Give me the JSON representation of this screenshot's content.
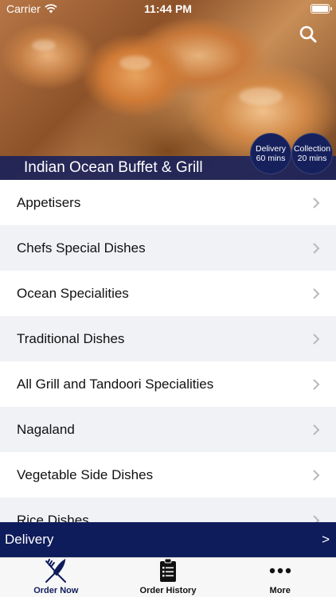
{
  "status_bar": {
    "carrier": "Carrier",
    "time": "11:44 PM"
  },
  "header": {
    "restaurant_name": "Indian Ocean Buffet & Grill",
    "delivery_badge": {
      "line1": "Delivery",
      "line2": "60 mins"
    },
    "collection_badge": {
      "line1": "Collection",
      "line2": "20 mins"
    },
    "search_icon": "search-icon"
  },
  "categories": [
    "Appetisers",
    "Chefs Special Dishes",
    "Ocean Specialities",
    "Traditional Dishes",
    "All Grill and Tandoori Specialities",
    "Nagaland",
    "Vegetable Side Dishes",
    "Rice Dishes"
  ],
  "order_mode_bar": {
    "label": "Delivery",
    "arrow": ">"
  },
  "tabs": [
    {
      "label": "Order Now",
      "icon": "fork-knife-icon",
      "active": true
    },
    {
      "label": "Order History",
      "icon": "clipboard-icon",
      "active": false
    },
    {
      "label": "More",
      "icon": "more-dots-icon",
      "active": false
    }
  ],
  "colors": {
    "brand_navy": "#16205c",
    "row_alt": "#f1f2f6"
  }
}
